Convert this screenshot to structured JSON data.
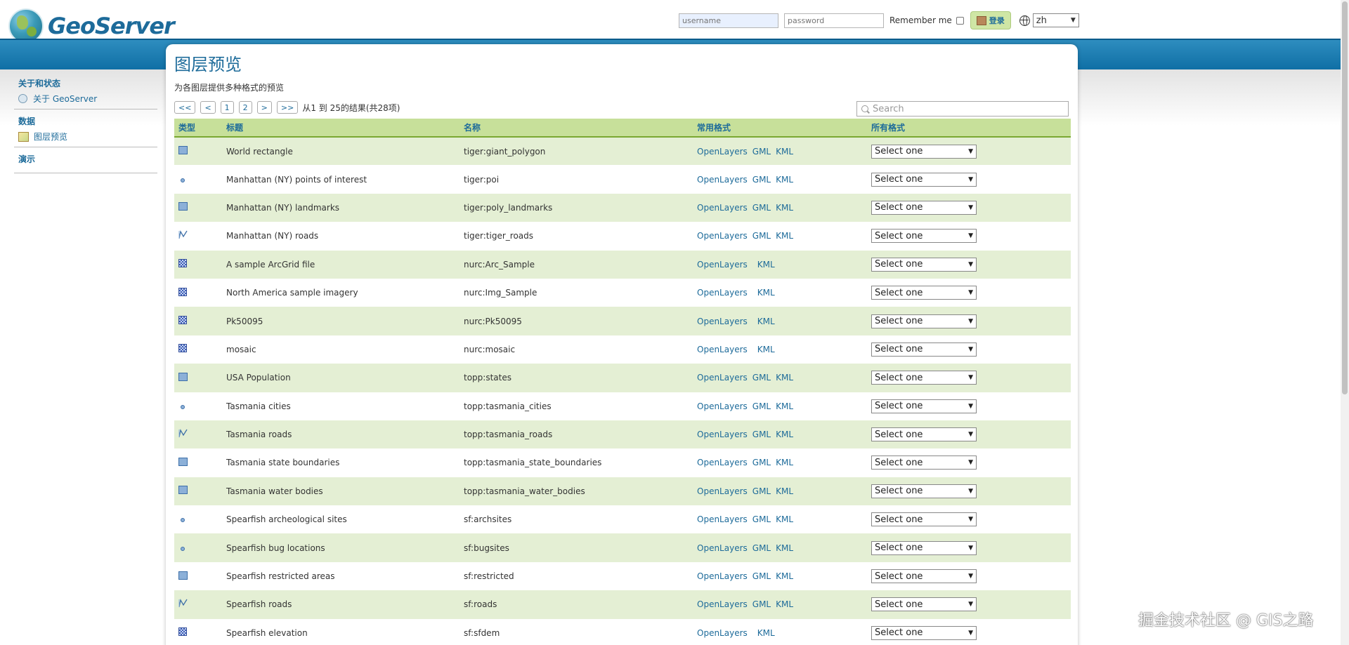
{
  "header": {
    "logo_text": "GeoServer",
    "username_placeholder": "username",
    "password_placeholder": "password",
    "remember_label": "Remember me",
    "login_label": "登录",
    "language": "zh"
  },
  "sidebar": {
    "groups": [
      {
        "heading": "关于和状态",
        "items": [
          {
            "label": "关于 GeoServer",
            "icon": "info-icon"
          }
        ]
      },
      {
        "heading": "数据",
        "items": [
          {
            "label": "图层预览",
            "icon": "layer-preview-icon"
          }
        ]
      },
      {
        "heading": "演示",
        "items": []
      }
    ]
  },
  "main": {
    "title": "图层预览",
    "subtitle": "为各图层提供多种格式的预览",
    "pager": {
      "first": "<<",
      "prev": "<",
      "pages": [
        "1",
        "2"
      ],
      "next": ">",
      "last": ">>",
      "info": "从1 到 25的结果(共28项)"
    },
    "search_placeholder": "Search",
    "columns": [
      "类型",
      "标题",
      "名称",
      "常用格式",
      "所有格式"
    ],
    "select_default": "Select one",
    "rows": [
      {
        "type": "polygon",
        "title": "World rectangle",
        "name": "tiger:giant_polygon",
        "formats": [
          "OpenLayers",
          "GML",
          "KML"
        ]
      },
      {
        "type": "point",
        "title": "Manhattan (NY) points of interest",
        "name": "tiger:poi",
        "formats": [
          "OpenLayers",
          "GML",
          "KML"
        ]
      },
      {
        "type": "polygon",
        "title": "Manhattan (NY) landmarks",
        "name": "tiger:poly_landmarks",
        "formats": [
          "OpenLayers",
          "GML",
          "KML"
        ]
      },
      {
        "type": "line",
        "title": "Manhattan (NY) roads",
        "name": "tiger:tiger_roads",
        "formats": [
          "OpenLayers",
          "GML",
          "KML"
        ]
      },
      {
        "type": "raster",
        "title": "A sample ArcGrid file",
        "name": "nurc:Arc_Sample",
        "formats": [
          "OpenLayers",
          "",
          "KML"
        ]
      },
      {
        "type": "raster",
        "title": "North America sample imagery",
        "name": "nurc:Img_Sample",
        "formats": [
          "OpenLayers",
          "",
          "KML"
        ]
      },
      {
        "type": "raster",
        "title": "Pk50095",
        "name": "nurc:Pk50095",
        "formats": [
          "OpenLayers",
          "",
          "KML"
        ]
      },
      {
        "type": "raster",
        "title": "mosaic",
        "name": "nurc:mosaic",
        "formats": [
          "OpenLayers",
          "",
          "KML"
        ]
      },
      {
        "type": "polygon",
        "title": "USA Population",
        "name": "topp:states",
        "formats": [
          "OpenLayers",
          "GML",
          "KML"
        ]
      },
      {
        "type": "point",
        "title": "Tasmania cities",
        "name": "topp:tasmania_cities",
        "formats": [
          "OpenLayers",
          "GML",
          "KML"
        ]
      },
      {
        "type": "line",
        "title": "Tasmania roads",
        "name": "topp:tasmania_roads",
        "formats": [
          "OpenLayers",
          "GML",
          "KML"
        ]
      },
      {
        "type": "polygon",
        "title": "Tasmania state boundaries",
        "name": "topp:tasmania_state_boundaries",
        "formats": [
          "OpenLayers",
          "GML",
          "KML"
        ]
      },
      {
        "type": "polygon",
        "title": "Tasmania water bodies",
        "name": "topp:tasmania_water_bodies",
        "formats": [
          "OpenLayers",
          "GML",
          "KML"
        ]
      },
      {
        "type": "point",
        "title": "Spearfish archeological sites",
        "name": "sf:archsites",
        "formats": [
          "OpenLayers",
          "GML",
          "KML"
        ]
      },
      {
        "type": "point",
        "title": "Spearfish bug locations",
        "name": "sf:bugsites",
        "formats": [
          "OpenLayers",
          "GML",
          "KML"
        ]
      },
      {
        "type": "polygon",
        "title": "Spearfish restricted areas",
        "name": "sf:restricted",
        "formats": [
          "OpenLayers",
          "GML",
          "KML"
        ]
      },
      {
        "type": "line",
        "title": "Spearfish roads",
        "name": "sf:roads",
        "formats": [
          "OpenLayers",
          "GML",
          "KML"
        ]
      },
      {
        "type": "raster",
        "title": "Spearfish elevation",
        "name": "sf:sfdem",
        "formats": [
          "OpenLayers",
          "",
          "KML"
        ]
      }
    ]
  },
  "watermark": "掘金技术社区 @ GIS之路",
  "colors": {
    "brand_blue": "#1d6b9a",
    "band_blue": "#0f6fa5",
    "header_green": "#c7e09a",
    "row_green": "#e4efd4"
  }
}
